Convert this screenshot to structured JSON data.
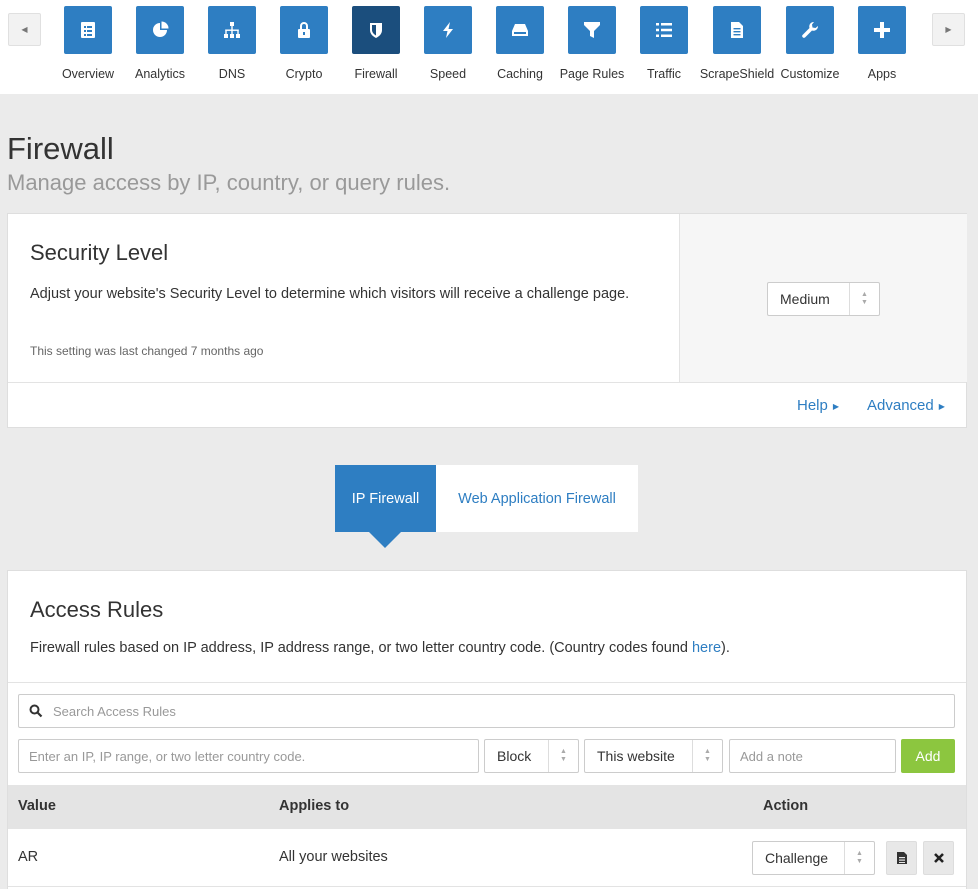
{
  "nav": {
    "items": [
      {
        "label": "Overview",
        "icon": "overview-icon"
      },
      {
        "label": "Analytics",
        "icon": "pie-chart-icon"
      },
      {
        "label": "DNS",
        "icon": "network-icon"
      },
      {
        "label": "Crypto",
        "icon": "lock-icon"
      },
      {
        "label": "Firewall",
        "icon": "shield-icon",
        "active": true
      },
      {
        "label": "Speed",
        "icon": "lightning-icon"
      },
      {
        "label": "Caching",
        "icon": "hard-drive-icon"
      },
      {
        "label": "Page Rules",
        "icon": "filter-icon"
      },
      {
        "label": "Traffic",
        "icon": "list-icon"
      },
      {
        "label": "ScrapeShield",
        "icon": "document-icon"
      },
      {
        "label": "Customize",
        "icon": "wrench-icon"
      },
      {
        "label": "Apps",
        "icon": "plus-icon"
      }
    ]
  },
  "page": {
    "title": "Firewall",
    "subtitle": "Manage access by IP, country, or query rules."
  },
  "security": {
    "title": "Security Level",
    "description": "Adjust your website's Security Level to determine which visitors will receive a challenge page.",
    "meta": "This setting was last changed 7 months ago",
    "level": "Medium",
    "help_link": "Help",
    "advanced_link": "Advanced"
  },
  "tabs": {
    "ip": "IP Firewall",
    "waf": "Web Application Firewall"
  },
  "rules": {
    "title": "Access Rules",
    "description_prefix": "Firewall rules based on IP address, IP address range, or two letter country code. (Country codes found ",
    "description_link": "here",
    "description_suffix": ").",
    "search_placeholder": "Search Access Rules",
    "ip_placeholder": "Enter an IP, IP range, or two letter country code.",
    "mode_value": "Block",
    "scope_value": "This website",
    "note_placeholder": "Add a note",
    "add_label": "Add",
    "columns": {
      "value": "Value",
      "applies": "Applies to",
      "action": "Action"
    },
    "rows": [
      {
        "value": "AR",
        "applies": "All your websites",
        "action": "Challenge"
      }
    ]
  },
  "colors": {
    "accent": "#2e7ec2",
    "active_nav": "#1b4e7d",
    "add_button": "#8cc63f"
  }
}
